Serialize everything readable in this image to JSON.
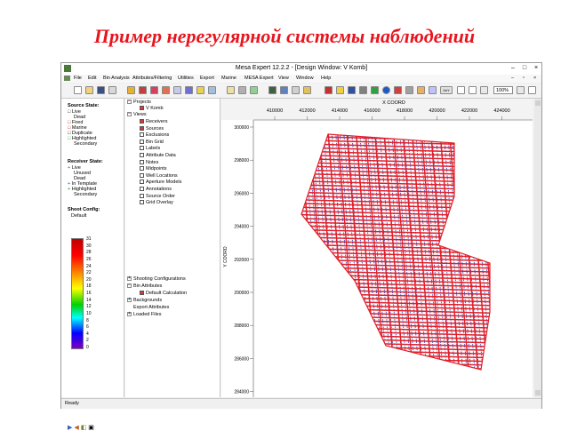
{
  "slide": {
    "title": "Пример нерегулярной системы наблюдений"
  },
  "window": {
    "title": "Mesa Expert 12.2.2 - [Design Window: V Komb]",
    "status": "Ready"
  },
  "menu": [
    "File",
    "Edit",
    "Bin Analysis",
    "Attributes/Filtering",
    "Utilities",
    "Export",
    "Marine",
    "MESA Expert",
    "View",
    "Window",
    "Help"
  ],
  "toolbar": {
    "zoom": "100%",
    "xy_label": "XeY"
  },
  "left_panel": {
    "source_state": {
      "heading": "Source State:",
      "items": [
        "Live",
        "Dead",
        "Fired",
        "Marine",
        "Duplicate",
        "Highlighted",
        "Secondary"
      ]
    },
    "receiver_state": {
      "heading": "Receiver State:",
      "items": [
        "Live",
        "Unused",
        "Dead",
        "In Template",
        "Highlighted",
        "Secondary"
      ]
    },
    "shoot_config": {
      "heading": "Shoot Config:",
      "value": "Default"
    },
    "colorbar_ticks": [
      "31",
      "30",
      "28",
      "26",
      "24",
      "22",
      "20",
      "18",
      "16",
      "14",
      "12",
      "10",
      "8",
      "6",
      "4",
      "2",
      "0"
    ]
  },
  "tree": {
    "projects": "Projects",
    "project": "V Komb",
    "views": "Views",
    "view_items": [
      {
        "label": "Receivers",
        "checked": true
      },
      {
        "label": "Sources",
        "checked": true
      },
      {
        "label": "Exclusions",
        "checked": false
      },
      {
        "label": "Bin Grid",
        "checked": false
      },
      {
        "label": "Labels",
        "checked": false
      },
      {
        "label": "Attribute Data",
        "checked": false
      },
      {
        "label": "Notes",
        "checked": false
      },
      {
        "label": "Midpoints",
        "checked": false
      },
      {
        "label": "Well Locations",
        "checked": false
      },
      {
        "label": "Aperture Models",
        "checked": false
      },
      {
        "label": "Annotations",
        "checked": false
      },
      {
        "label": "Source Order",
        "checked": false
      },
      {
        "label": "Grid Overlay",
        "checked": false
      }
    ],
    "shooting": "Shooting Configurations",
    "bin_attributes": "Bin Attributes",
    "default_calc": "Default Calculation",
    "backgrounds": "Backgrounds",
    "export_attributes": "Export Attributes",
    "loaded_files": "Loaded Files"
  },
  "map": {
    "x_axis_title": "X COORD",
    "y_axis_title": "Y COORD",
    "x_ticks": [
      "410000",
      "412000",
      "414000",
      "416000",
      "418000",
      "420000",
      "422000",
      "424000"
    ],
    "y_ticks": [
      "300000",
      "298000",
      "296000",
      "294000",
      "292000",
      "290000",
      "288000",
      "286000",
      "284000"
    ],
    "colors": {
      "receiver_lines": "#e0202a",
      "source_lines": "#3048c8"
    }
  }
}
